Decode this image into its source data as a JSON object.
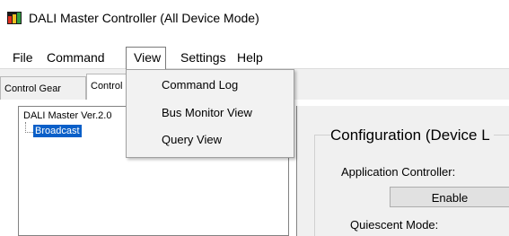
{
  "window": {
    "title": "DALI Master Controller (All Device Mode)"
  },
  "menubar": {
    "items": [
      "File",
      "Command",
      "View",
      "Settings",
      "Help"
    ]
  },
  "view_menu": {
    "items": [
      "Command Log",
      "Bus Monitor View",
      "Query View"
    ]
  },
  "tabs": [
    "Control Gear",
    "Control Device"
  ],
  "tree": {
    "root": "DALI Master Ver.2.0",
    "child": "Broadcast"
  },
  "config": {
    "title": "Configuration (Device L",
    "app_controller_label": "Application Controller:",
    "enable_button": "Enable",
    "quiescent_label": "Quiescent Mode:"
  },
  "colors": {
    "selection": "#0a5fc8",
    "panel": "#f0f0f0",
    "menu_bg": "#f2f2f2"
  }
}
